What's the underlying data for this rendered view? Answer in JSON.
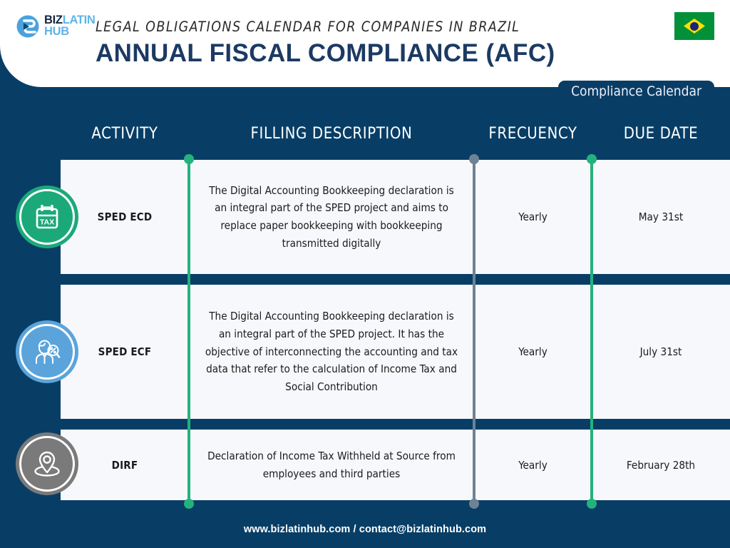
{
  "brand": {
    "logo_line1_bold": "BIZ",
    "logo_line1_light": "LATIN",
    "logo_line2": "HUB",
    "logo_icon": "bizlatinhub-logo-icon"
  },
  "header": {
    "subtitle": "LEGAL OBLIGATIONS CALENDAR FOR COMPANIES IN BRAZIL",
    "title": "ANNUAL FISCAL COMPLIANCE (AFC)",
    "flag_icon": "brazil-flag-icon",
    "badge": "Compliance Calendar"
  },
  "table": {
    "headers": {
      "activity": "ACTIVITY",
      "description": "FILLING DESCRIPTION",
      "frecuency": "FRECUENCY",
      "due_date": "DUE DATE"
    },
    "rows": [
      {
        "icon": "tax-calendar-icon",
        "icon_color": "#1BA97A",
        "activity": "SPED ECD",
        "description": "The Digital Accounting Bookkeeping declaration is an integral part of the SPED project and aims to replace paper bookkeeping with bookkeeping transmitted digitally",
        "frecuency": "Yearly",
        "due_date": "May 31st"
      },
      {
        "icon": "person-magnifier-icon",
        "icon_color": "#5BA4DB",
        "activity": "SPED ECF",
        "description": "The Digital Accounting Bookkeeping declaration is an integral part of the SPED project. It has the objective of interconnecting the accounting and tax data that refer to the calculation of Income Tax and Social Contribution",
        "frecuency": "Yearly",
        "due_date": "July 31st"
      },
      {
        "icon": "location-pin-icon",
        "icon_color": "#7A7A7A",
        "activity": "DIRF",
        "description": "Declaration of Income Tax Withheld at Source from employees and third parties",
        "frecuency": "Yearly",
        "due_date": "February 28th"
      }
    ]
  },
  "dividers": [
    {
      "name": "divider-activity-description",
      "color": "#23B27C"
    },
    {
      "name": "divider-description-frecuency",
      "color": "#6E8296"
    },
    {
      "name": "divider-frecuency-duedate",
      "color": "#23B27C"
    }
  ],
  "footer": {
    "text": "www.bizlatinhub.com / contact@bizlatinhub.com"
  },
  "colors": {
    "navy_background": "#083E66",
    "badge_navy": "#0A3D66",
    "row_background": "#F7F8FC",
    "title_navy": "#1B3A63",
    "accent_green": "#23B27C",
    "accent_gray": "#6E8296",
    "flag_green": "#029139",
    "flag_yellow": "#FFDF00",
    "flag_blue": "#19247C"
  }
}
